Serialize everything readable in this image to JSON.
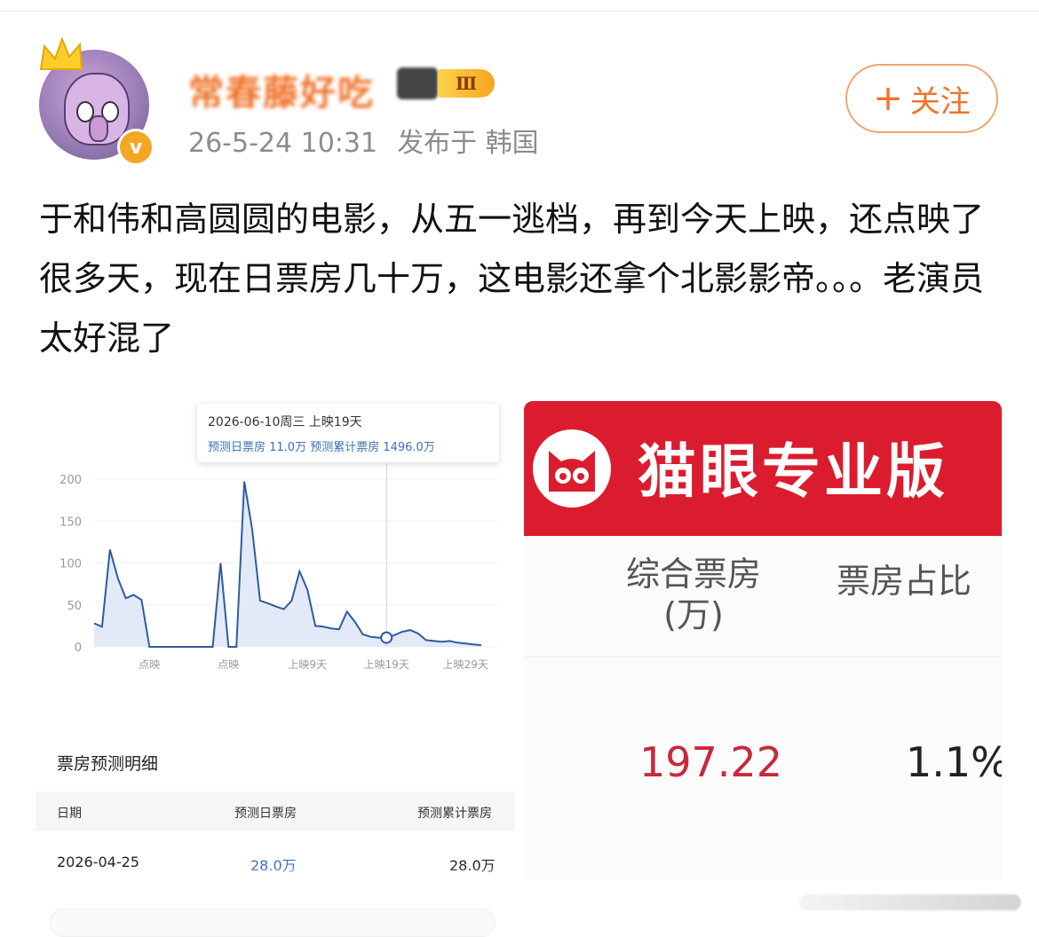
{
  "post": {
    "author_name": "常春藤好吃",
    "level_badge": "Ⅲ",
    "verified_badge": "v",
    "time": "26-5-24 10:31",
    "location": "发布于 韩国",
    "follow_label": "关注",
    "follow_plus": "+",
    "content": "于和伟和高圆圆的电影，从五一逃档，再到今天上映，还点映了很多天，现在日票房几十万，这电影还拿个北影影帝。。。老演员太好混了"
  },
  "left_image": {
    "tooltip": {
      "line1": "2026-06-10周三   上映19天",
      "line2": "预测日票房 11.0万   预测累计票房 1496.0万"
    },
    "section_title": "票房预测明细",
    "table": {
      "headers": [
        "日期",
        "预测日票房",
        "预测累计票房"
      ],
      "rows": [
        [
          "2026-04-25",
          "28.0万",
          "28.0万"
        ]
      ]
    },
    "colors": {
      "line": "#2f5c9e",
      "fill": "#dfe8f6",
      "tooltip_text": "#3d6fb6"
    }
  },
  "chart_data": {
    "type": "area",
    "title": "",
    "xlabel": "",
    "ylabel": "",
    "ylim": [
      0,
      200
    ],
    "yticks": [
      0,
      50,
      100,
      150,
      200
    ],
    "xtick_labels": [
      {
        "index": 7,
        "label": "点映"
      },
      {
        "index": 17,
        "label": "点映"
      },
      {
        "index": 27,
        "label": "上映9天"
      },
      {
        "index": 37,
        "label": "上映19天"
      },
      {
        "index": 47,
        "label": "上映29天"
      }
    ],
    "highlight_index": 37,
    "x": [
      0,
      1,
      2,
      3,
      4,
      5,
      6,
      7,
      8,
      9,
      10,
      11,
      12,
      13,
      14,
      15,
      16,
      17,
      18,
      19,
      20,
      21,
      22,
      23,
      24,
      25,
      26,
      27,
      28,
      29,
      30,
      31,
      32,
      33,
      34,
      35,
      36,
      37,
      38,
      39,
      40,
      41,
      42,
      43,
      44,
      45,
      46,
      47,
      48,
      49
    ],
    "values": [
      28,
      24,
      116,
      82,
      58,
      62,
      56,
      0,
      0,
      0,
      0,
      0,
      0,
      0,
      0,
      0,
      100,
      0,
      0,
      197,
      140,
      55,
      52,
      48,
      45,
      55,
      90,
      68,
      25,
      24,
      22,
      21,
      42,
      30,
      15,
      12,
      11,
      11,
      14,
      18,
      20,
      16,
      8,
      7,
      6,
      7,
      5,
      4,
      3,
      2
    ]
  },
  "right_image": {
    "brand_title": "猫眼专业版",
    "col1_header_line1": "综合票房",
    "col1_header_line2": "(万)",
    "col2_header": "票房占比",
    "col1_value": "197.22",
    "col2_value": "1.1%",
    "colors": {
      "brand_red": "#db1c2e",
      "value_red": "#c8283c"
    }
  }
}
